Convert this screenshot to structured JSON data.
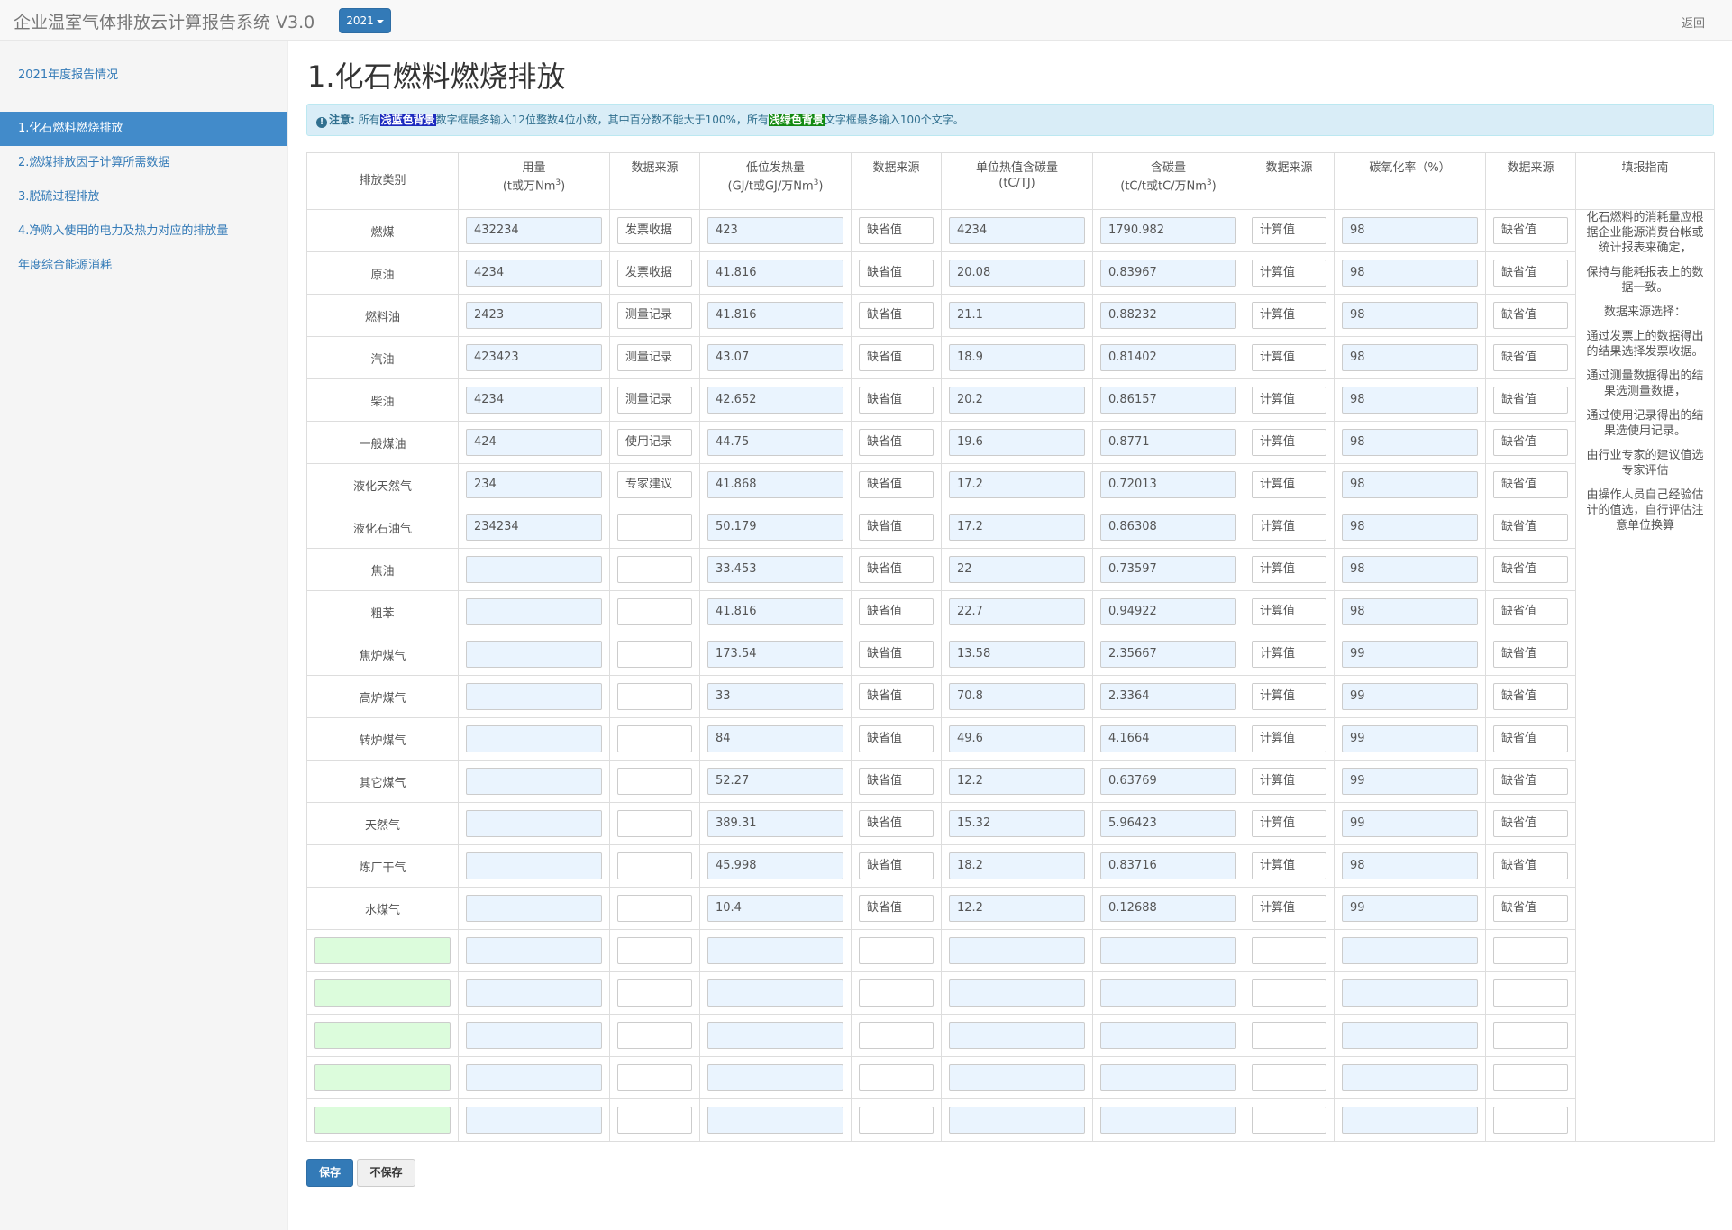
{
  "header": {
    "brand": "企业温室气体排放云计算报告系统 V3.0",
    "year": "2021",
    "back": "返回"
  },
  "sidebar": {
    "items": [
      {
        "label": "2021年度报告情况",
        "active": false
      },
      {
        "label": "1.化石燃料燃烧排放",
        "active": true
      },
      {
        "label": "2.燃煤排放因子计算所需数据",
        "active": false
      },
      {
        "label": "3.脱硫过程排放",
        "active": false
      },
      {
        "label": "4.净购入使用的电力及热力对应的排放量",
        "active": false
      },
      {
        "label": "年度综合能源消耗",
        "active": false
      }
    ]
  },
  "main": {
    "title": "1.化石燃料燃烧排放",
    "notice": {
      "strong": "注意:",
      "part1": "所有",
      "blue_bg": "浅蓝色背景",
      "part2": "数字框最多输入12位整数4位小数，其中百分数不能大于100%，所有",
      "green_bg": "浅绿色背景",
      "part3": "文字框最多输入100个文字。"
    },
    "headers": {
      "category": "排放类别",
      "usage": "用量",
      "usage_unit_pre": "(t或万Nm",
      "source": "数据来源",
      "ncv": "低位发热量",
      "ncv_unit_pre": "(GJ/t或GJ/万Nm",
      "carbon_per_heat": "单位热值含碳量",
      "carbon_per_heat_unit": "(tC/TJ)",
      "carbon_content": "含碳量",
      "carbon_content_unit_pre": "(tC/t或tC/万Nm",
      "oxidation": "碳氧化率（%）",
      "guide": "填报指南",
      "sup": "3",
      "close": ")"
    },
    "rows": [
      {
        "cat": "燃煤",
        "usage": "432234",
        "src1": "发票收据",
        "ncv": "423",
        "src2": "缺省值",
        "cph": "4234",
        "cc": "1790.982",
        "src3": "计算值",
        "ox": "98",
        "src4": "缺省值"
      },
      {
        "cat": "原油",
        "usage": "4234",
        "src1": "发票收据",
        "ncv": "41.816",
        "src2": "缺省值",
        "cph": "20.08",
        "cc": "0.83967",
        "src3": "计算值",
        "ox": "98",
        "src4": "缺省值"
      },
      {
        "cat": "燃料油",
        "usage": "2423",
        "src1": "测量记录",
        "ncv": "41.816",
        "src2": "缺省值",
        "cph": "21.1",
        "cc": "0.88232",
        "src3": "计算值",
        "ox": "98",
        "src4": "缺省值"
      },
      {
        "cat": "汽油",
        "usage": "423423",
        "src1": "测量记录",
        "ncv": "43.07",
        "src2": "缺省值",
        "cph": "18.9",
        "cc": "0.81402",
        "src3": "计算值",
        "ox": "98",
        "src4": "缺省值"
      },
      {
        "cat": "柴油",
        "usage": "4234",
        "src1": "测量记录",
        "ncv": "42.652",
        "src2": "缺省值",
        "cph": "20.2",
        "cc": "0.86157",
        "src3": "计算值",
        "ox": "98",
        "src4": "缺省值"
      },
      {
        "cat": "一般煤油",
        "usage": "424",
        "src1": "使用记录",
        "ncv": "44.75",
        "src2": "缺省值",
        "cph": "19.6",
        "cc": "0.8771",
        "src3": "计算值",
        "ox": "98",
        "src4": "缺省值"
      },
      {
        "cat": "液化天然气",
        "usage": "234",
        "src1": "专家建议",
        "ncv": "41.868",
        "src2": "缺省值",
        "cph": "17.2",
        "cc": "0.72013",
        "src3": "计算值",
        "ox": "98",
        "src4": "缺省值"
      },
      {
        "cat": "液化石油气",
        "usage": "234234",
        "src1": "",
        "ncv": "50.179",
        "src2": "缺省值",
        "cph": "17.2",
        "cc": "0.86308",
        "src3": "计算值",
        "ox": "98",
        "src4": "缺省值"
      },
      {
        "cat": "焦油",
        "usage": "",
        "src1": "",
        "ncv": "33.453",
        "src2": "缺省值",
        "cph": "22",
        "cc": "0.73597",
        "src3": "计算值",
        "ox": "98",
        "src4": "缺省值"
      },
      {
        "cat": "粗苯",
        "usage": "",
        "src1": "",
        "ncv": "41.816",
        "src2": "缺省值",
        "cph": "22.7",
        "cc": "0.94922",
        "src3": "计算值",
        "ox": "98",
        "src4": "缺省值"
      },
      {
        "cat": "焦炉煤气",
        "usage": "",
        "src1": "",
        "ncv": "173.54",
        "src2": "缺省值",
        "cph": "13.58",
        "cc": "2.35667",
        "src3": "计算值",
        "ox": "99",
        "src4": "缺省值"
      },
      {
        "cat": "高炉煤气",
        "usage": "",
        "src1": "",
        "ncv": "33",
        "src2": "缺省值",
        "cph": "70.8",
        "cc": "2.3364",
        "src3": "计算值",
        "ox": "99",
        "src4": "缺省值"
      },
      {
        "cat": "转炉煤气",
        "usage": "",
        "src1": "",
        "ncv": "84",
        "src2": "缺省值",
        "cph": "49.6",
        "cc": "4.1664",
        "src3": "计算值",
        "ox": "99",
        "src4": "缺省值"
      },
      {
        "cat": "其它煤气",
        "usage": "",
        "src1": "",
        "ncv": "52.27",
        "src2": "缺省值",
        "cph": "12.2",
        "cc": "0.63769",
        "src3": "计算值",
        "ox": "99",
        "src4": "缺省值"
      },
      {
        "cat": "天然气",
        "usage": "",
        "src1": "",
        "ncv": "389.31",
        "src2": "缺省值",
        "cph": "15.32",
        "cc": "5.96423",
        "src3": "计算值",
        "ox": "99",
        "src4": "缺省值"
      },
      {
        "cat": "炼厂干气",
        "usage": "",
        "src1": "",
        "ncv": "45.998",
        "src2": "缺省值",
        "cph": "18.2",
        "cc": "0.83716",
        "src3": "计算值",
        "ox": "98",
        "src4": "缺省值"
      },
      {
        "cat": "水煤气",
        "usage": "",
        "src1": "",
        "ncv": "10.4",
        "src2": "缺省值",
        "cph": "12.2",
        "cc": "0.12688",
        "src3": "计算值",
        "ox": "99",
        "src4": "缺省值"
      }
    ],
    "guide": [
      "化石燃料的消耗量应根据企业能源消费台帐或统计报表来确定，",
      "保持与能耗报表上的数据一致。",
      "数据来源选择：",
      "通过发票上的数据得出的结果选择发票收据。",
      "通过测量数据得出的结果选测量数据，",
      "通过使用记录得出的结果选使用记录。",
      "由行业专家的建议值选专家评估",
      "由操作人员自己经验估计的值选，自行评估注意单位换算"
    ],
    "blank_rows": 5
  },
  "actions": {
    "save": "保存",
    "nosave": "不保存"
  },
  "colors": {
    "primary": "#337ab7",
    "input_blue": "#eaf4fe",
    "input_green": "#dcfcdc",
    "notice_bg": "#d9edf7"
  }
}
